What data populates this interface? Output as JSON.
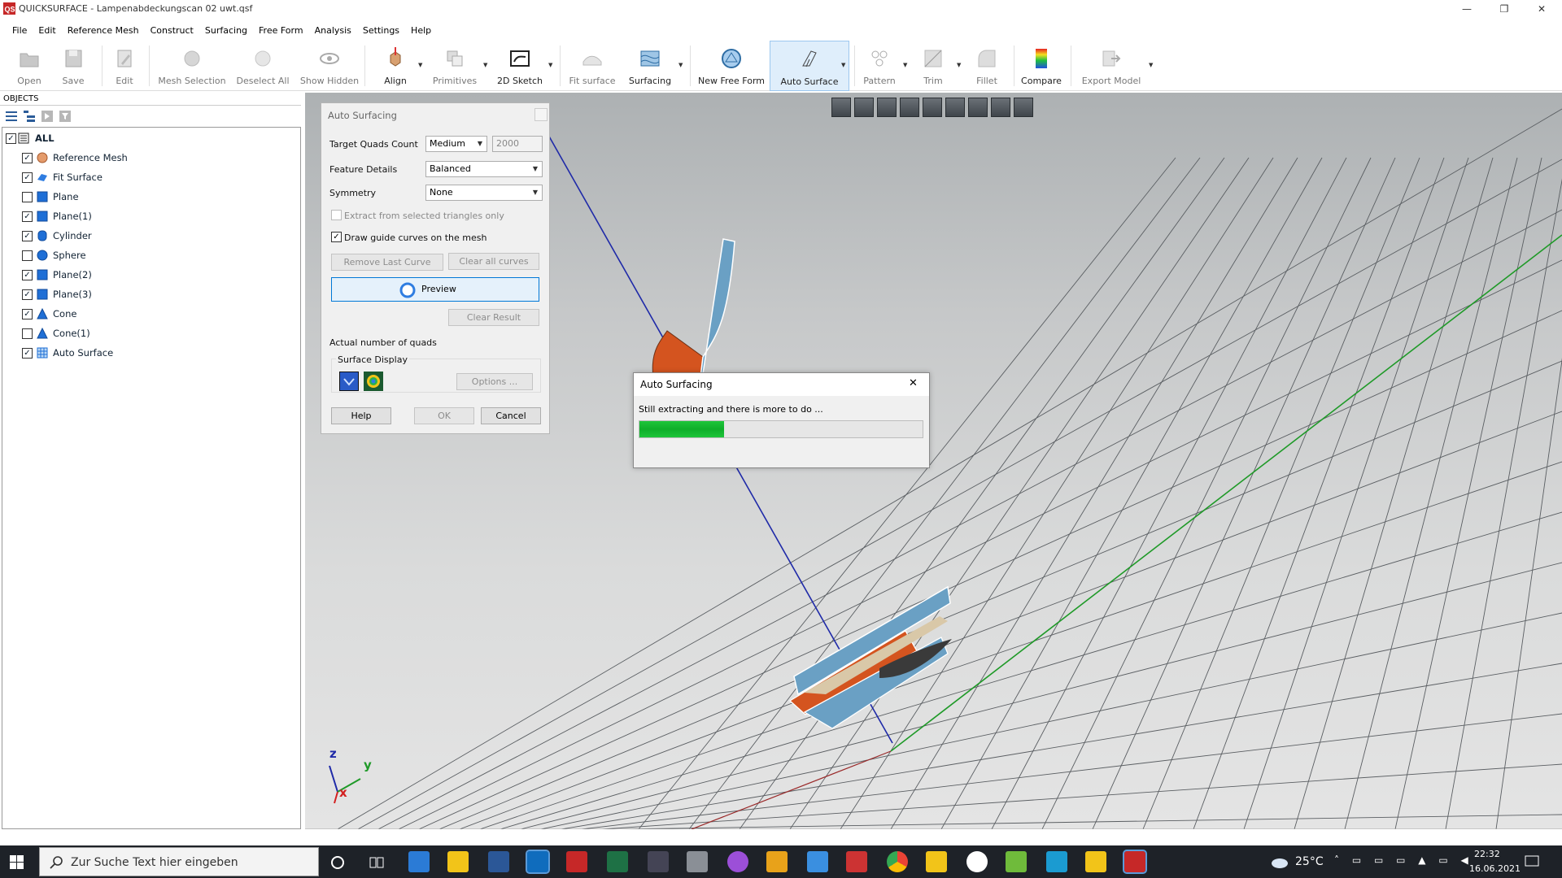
{
  "app": {
    "title": "QUICKSURFACE - Lampenabdeckungscan 02 uwt.qsf",
    "logo_text": "QS"
  },
  "window_controls": {
    "minimize": "—",
    "restore": "❐",
    "close": "✕"
  },
  "menu": [
    "File",
    "Edit",
    "Reference Mesh",
    "Construct",
    "Surfacing",
    "Free Form",
    "Analysis",
    "Settings",
    "Help"
  ],
  "toolbar": [
    {
      "label": "Open",
      "icon": "folder-icon",
      "enabled": false
    },
    {
      "label": "Save",
      "icon": "floppy-icon",
      "enabled": false
    },
    {
      "label": "Edit",
      "icon": "edit-icon",
      "enabled": false
    },
    {
      "label": "Mesh Selection",
      "icon": "mesh-selection-icon",
      "enabled": false
    },
    {
      "label": "Deselect All",
      "icon": "deselect-icon",
      "enabled": false
    },
    {
      "label": "Show Hidden",
      "icon": "eye-icon",
      "enabled": false
    },
    {
      "label": "Align",
      "icon": "align-icon",
      "enabled": true
    },
    {
      "label": "Primitives",
      "icon": "primitives-icon",
      "enabled": false
    },
    {
      "label": "2D Sketch",
      "icon": "sketch-icon",
      "enabled": true
    },
    {
      "label": "Fit surface",
      "icon": "fit-surface-icon",
      "enabled": false
    },
    {
      "label": "Surfacing",
      "icon": "surfacing-icon",
      "enabled": true
    },
    {
      "label": "New Free Form",
      "icon": "free-form-icon",
      "enabled": true
    },
    {
      "label": "Auto Surface",
      "icon": "auto-surface-icon",
      "enabled": true
    },
    {
      "label": "Pattern",
      "icon": "pattern-icon",
      "enabled": false
    },
    {
      "label": "Trim",
      "icon": "trim-icon",
      "enabled": false
    },
    {
      "label": "Fillet",
      "icon": "fillet-icon",
      "enabled": false
    },
    {
      "label": "Compare",
      "icon": "compare-icon",
      "enabled": true
    },
    {
      "label": "Export Model",
      "icon": "export-icon",
      "enabled": false
    }
  ],
  "objects": {
    "header": "OBJECTS",
    "root": "ALL",
    "items": [
      {
        "label": "Reference Mesh",
        "checked": true,
        "icon": "mesh-icon"
      },
      {
        "label": "Fit Surface",
        "checked": true,
        "icon": "fit-surface-icon"
      },
      {
        "label": "Plane",
        "checked": false,
        "icon": "plane-icon"
      },
      {
        "label": "Plane(1)",
        "checked": true,
        "icon": "plane-icon"
      },
      {
        "label": "Cylinder",
        "checked": true,
        "icon": "cylinder-icon"
      },
      {
        "label": "Sphere",
        "checked": false,
        "icon": "sphere-icon"
      },
      {
        "label": "Plane(2)",
        "checked": true,
        "icon": "plane-icon"
      },
      {
        "label": "Plane(3)",
        "checked": true,
        "icon": "plane-icon"
      },
      {
        "label": "Cone",
        "checked": true,
        "icon": "cone-icon"
      },
      {
        "label": "Cone(1)",
        "checked": false,
        "icon": "cone-icon"
      },
      {
        "label": "Auto Surface",
        "checked": true,
        "icon": "auto-surface-icon"
      }
    ]
  },
  "auto_surfacing": {
    "title": "Auto Surfacing",
    "target_quads_label": "Target Quads Count",
    "target_quads_value": "Medium",
    "target_quads_number": "2000",
    "feature_details_label": "Feature Details",
    "feature_details_value": "Balanced",
    "symmetry_label": "Symmetry",
    "symmetry_value": "None",
    "extract_label": "Extract from selected triangles only",
    "extract_checked": false,
    "guide_label": "Draw guide curves on the mesh",
    "guide_checked": true,
    "remove_last_curve": "Remove Last Curve",
    "clear_all_curves": "Clear all curves",
    "preview": "Preview",
    "clear_result": "Clear Result",
    "actual_quads_label": "Actual number of quads",
    "surface_display_label": "Surface Display",
    "options": "Options ...",
    "help": "Help",
    "ok": "OK",
    "cancel": "Cancel"
  },
  "progress_dialog": {
    "title": "Auto Surfacing",
    "message": "Still extracting and there is more to do ...",
    "progress": 0.3,
    "close": "✕"
  },
  "axis_labels": {
    "z": "z",
    "y": "y",
    "x": "x"
  },
  "taskbar": {
    "search_placeholder": "Zur Suche Text hier eingeben",
    "temperature": "25°C",
    "time": "22:32",
    "date": "16.06.2021"
  },
  "colors": {
    "accent_blue": "#2f7de1",
    "progress_green": "#21b533",
    "surface_orange": "#d4541f",
    "surface_blue": "#6aa0c4"
  }
}
